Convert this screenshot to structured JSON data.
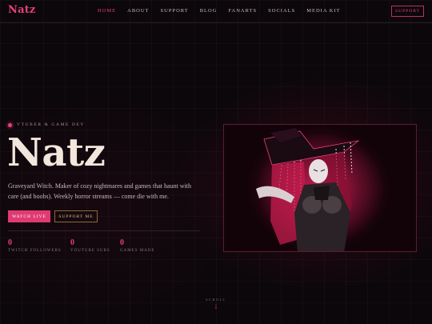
{
  "nav": {
    "logo": "Natz",
    "links": [
      "HOME",
      "ABOUT",
      "SUPPORT",
      "BLOG",
      "FANARTS",
      "SOCIALS",
      "MEDIA KIT"
    ],
    "active_index": 0,
    "support_button": "SUPPORT"
  },
  "hero": {
    "eyebrow": "VTUBER & GAME DEV",
    "title": "Natz",
    "description": "Graveyard Witch. Maker of cozy nightmares and games that haunt with care (and boobs). Weekly horror streams — come die with me.",
    "primary_button": "WATCH LIVE",
    "secondary_button": "SUPPORT ME"
  },
  "stats": [
    {
      "value": "0",
      "label": "TWITCH FOLLOWERS"
    },
    {
      "value": "0",
      "label": "YOUTUBE SUBS"
    },
    {
      "value": "0",
      "label": "GAMES MADE"
    }
  ],
  "scroll": {
    "label": "SCROLL",
    "arrow": "↓"
  },
  "colors": {
    "accent": "#e8407a",
    "background": "#0b070a",
    "gold": "#d9b68a"
  }
}
